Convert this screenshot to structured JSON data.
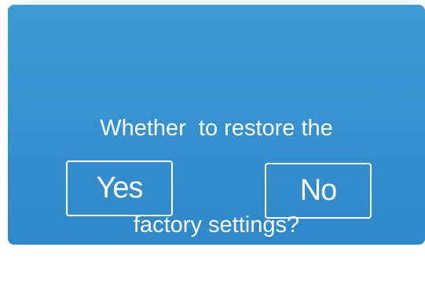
{
  "dialog": {
    "message_line1": "Whether  to restore the",
    "message_line2": "factory settings?",
    "yes_label": "Yes",
    "no_label": "No"
  },
  "colors": {
    "dialog_top": "#3d9ad6",
    "dialog_bottom": "#2f88c9",
    "text": "#ffffff"
  }
}
